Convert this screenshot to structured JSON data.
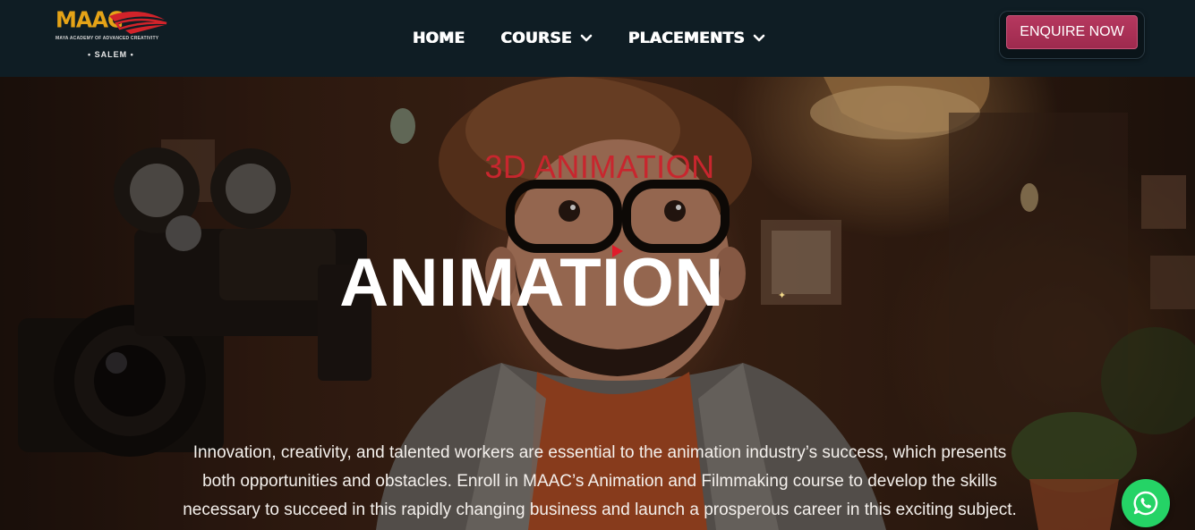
{
  "brand": {
    "logo_text": "MAAC",
    "tagline": "MAYA ACADEMY OF ADVANCED CREATIVITY",
    "city": "• SALEM •",
    "accent_color": "#e5a317"
  },
  "nav": {
    "items": [
      {
        "label": "HOME",
        "has_dropdown": false
      },
      {
        "label": "COURSE",
        "has_dropdown": true
      },
      {
        "label": "PLACEMENTS",
        "has_dropdown": true
      }
    ]
  },
  "cta": {
    "label": "ENQUIRE NOW",
    "color": "#a8305a"
  },
  "hero": {
    "subtitle": "3D ANIMATION",
    "title": "ANIMATION",
    "description": "Innovation, creativity, and talented workers are essential to the animation industry’s success, which presents both opportunities and obstacles. Enroll in MAAC’s Animation and Filmmaking course to develop the skills necessary to succeed in this rapidly changing business and launch a prosperous career in this exciting subject.",
    "subtitle_color": "#c8262e"
  },
  "chat": {
    "icon": "whatsapp-icon",
    "color": "#25d366"
  }
}
